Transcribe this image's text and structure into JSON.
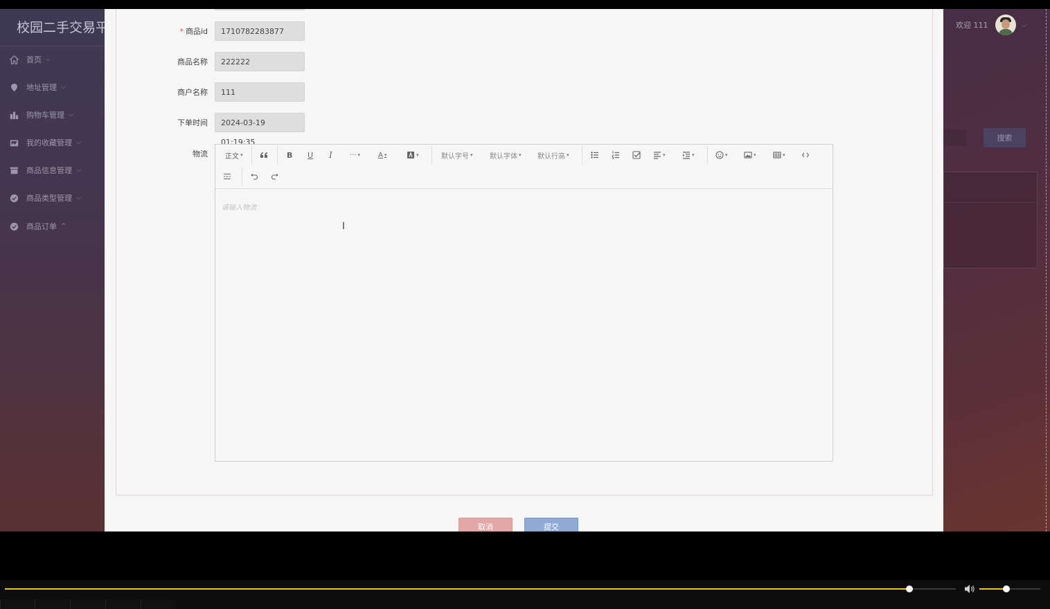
{
  "app": {
    "title": "校园二手交易平",
    "welcome": "欢迎 111",
    "search_button": "搜索",
    "sidebar": [
      {
        "label": "首页",
        "icon": "home-icon",
        "expanded": false
      },
      {
        "label": "地址管理",
        "icon": "location-icon",
        "expanded": false
      },
      {
        "label": "购物车管理",
        "icon": "cart-icon",
        "expanded": false
      },
      {
        "label": "我的收藏管理",
        "icon": "collection-icon",
        "expanded": false
      },
      {
        "label": "商品信息管理",
        "icon": "goods-info-icon",
        "expanded": false
      },
      {
        "label": "商品类型管理",
        "icon": "goods-type-icon",
        "expanded": false
      },
      {
        "label": "商品订单",
        "icon": "order-icon",
        "expanded": true
      }
    ],
    "chevron_down": "⌵",
    "chevron_up": "^"
  },
  "form": {
    "fields": [
      {
        "label": "商品id",
        "required": true,
        "value": "1710782283877"
      },
      {
        "label": "商品名称",
        "required": false,
        "value": "222222"
      },
      {
        "label": "商户名称",
        "required": false,
        "value": "111"
      },
      {
        "label": "下单时间",
        "required": false,
        "value": "2024-03-19 01:19:35"
      }
    ],
    "required_mark": "*",
    "editor": {
      "label": "物流",
      "placeholder": "请输入物流",
      "toolbar": {
        "heading": "正文",
        "font_size": "默认字号",
        "font_family": "默认字体",
        "line_height": "默认行高",
        "more": "···"
      }
    },
    "cancel_label": "取消",
    "submit_label": "提交"
  },
  "player": {
    "progress": 0.951,
    "volume": 0.44,
    "accent_color": "#f2c81b"
  }
}
